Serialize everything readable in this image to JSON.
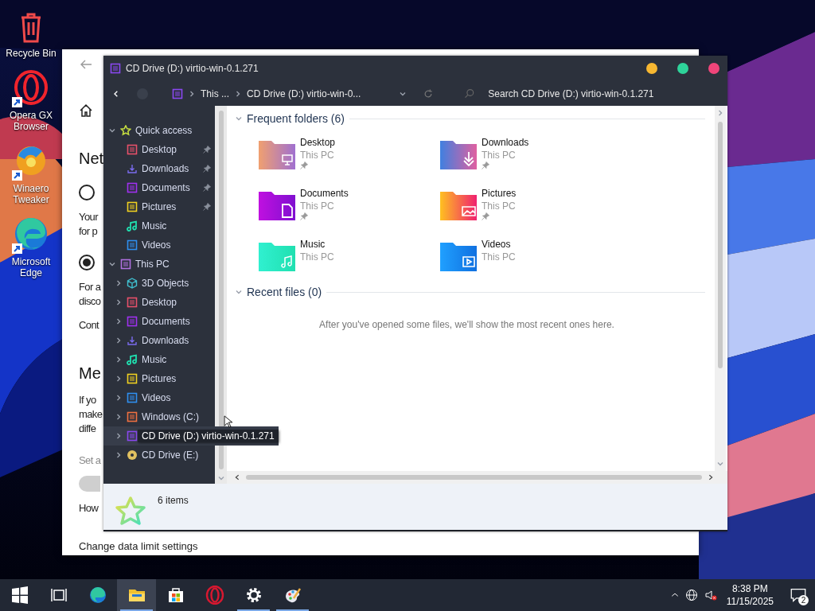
{
  "desktop_icons": [
    {
      "label": "Recycle Bin",
      "kind": "recycle",
      "shortcut": false
    },
    {
      "label": "Opera GX Browser",
      "kind": "opera",
      "shortcut": true
    },
    {
      "label": "Winaero Tweaker",
      "kind": "winaero",
      "shortcut": true
    },
    {
      "label": "Microsoft Edge",
      "kind": "edge",
      "shortcut": true
    }
  ],
  "settings_window": {
    "items": [
      {
        "kind": "heading",
        "text": "Net"
      },
      {
        "kind": "radio",
        "selected": false
      },
      {
        "kind": "text",
        "lines": [
          "Your",
          "for p"
        ]
      },
      {
        "kind": "radio",
        "selected": true
      },
      {
        "kind": "text",
        "lines": [
          "For a",
          "disco"
        ]
      },
      {
        "kind": "text",
        "lines": [
          "Cont"
        ]
      },
      {
        "kind": "heading",
        "text": "Me"
      },
      {
        "kind": "text",
        "lines": [
          "If yo",
          "make",
          "diffe"
        ]
      },
      {
        "kind": "hint",
        "text": "Set a"
      },
      {
        "kind": "toggle",
        "on": false
      },
      {
        "kind": "text",
        "lines": [
          "How"
        ]
      },
      {
        "kind": "link",
        "text": "Change data limit settings"
      }
    ]
  },
  "explorer": {
    "title": "CD Drive (D:) virtio-win-0.1.271",
    "breadcrumb": [
      "This ...",
      "CD Drive (D:) virtio-win-0..."
    ],
    "search": {
      "placeholder": "Search CD Drive (D:) virtio-win-0.1.271"
    },
    "nav": [
      {
        "label": "Quick access",
        "kind": "star",
        "expanded": true,
        "children": [
          {
            "label": "Desktop",
            "kind": "desktop",
            "pinned": true
          },
          {
            "label": "Downloads",
            "kind": "downloads",
            "pinned": true
          },
          {
            "label": "Documents",
            "kind": "documents",
            "pinned": true
          },
          {
            "label": "Pictures",
            "kind": "pictures",
            "pinned": true
          },
          {
            "label": "Music",
            "kind": "music",
            "pinned": false
          },
          {
            "label": "Videos",
            "kind": "videos",
            "pinned": false
          }
        ]
      },
      {
        "label": "This PC",
        "kind": "pc",
        "expanded": true,
        "children": [
          {
            "label": "3D Objects",
            "kind": "cube",
            "expanded": false,
            "hovered": false
          },
          {
            "label": "Desktop",
            "kind": "desktop",
            "expanded": false,
            "hovered": false
          },
          {
            "label": "Documents",
            "kind": "documents",
            "expanded": false,
            "hovered": false
          },
          {
            "label": "Downloads",
            "kind": "downloads",
            "expanded": false,
            "hovered": false
          },
          {
            "label": "Music",
            "kind": "music",
            "expanded": false,
            "hovered": false
          },
          {
            "label": "Pictures",
            "kind": "pictures",
            "expanded": false,
            "hovered": false
          },
          {
            "label": "Videos",
            "kind": "videos",
            "expanded": false,
            "hovered": false
          },
          {
            "label": "Windows (C:)",
            "kind": "drive-c",
            "expanded": false,
            "hovered": false
          },
          {
            "label": "CD Drive (D:) virtio-win-0.1.271",
            "kind": "cd-d",
            "expanded": false,
            "hovered": true
          },
          {
            "label": "CD Drive (E:)",
            "kind": "disc",
            "expanded": false,
            "hovered": false
          }
        ]
      }
    ],
    "sections": [
      {
        "title": "Frequent folders (6)",
        "expanded": true,
        "folders": [
          {
            "name": "Desktop",
            "location": "This PC",
            "kind": "desktop",
            "pinned": true
          },
          {
            "name": "Downloads",
            "location": "This PC",
            "kind": "downloads",
            "pinned": true
          },
          {
            "name": "Documents",
            "location": "This PC",
            "kind": "documents",
            "pinned": true
          },
          {
            "name": "Pictures",
            "location": "This PC",
            "kind": "pictures",
            "pinned": true
          },
          {
            "name": "Music",
            "location": "This PC",
            "kind": "music",
            "pinned": false
          },
          {
            "name": "Videos",
            "location": "This PC",
            "kind": "videos",
            "pinned": false
          }
        ]
      },
      {
        "title": "Recent files (0)",
        "expanded": true,
        "empty_text": "After you've opened some files, we'll show the most recent ones here."
      }
    ],
    "status": {
      "item_count": "6 items"
    }
  },
  "taskbar": {
    "apps": [
      {
        "kind": "start",
        "running": false,
        "selected": false
      },
      {
        "kind": "task-view",
        "running": false,
        "selected": false
      },
      {
        "kind": "edge",
        "running": false,
        "selected": false
      },
      {
        "kind": "explorer",
        "running": true,
        "selected": true
      },
      {
        "kind": "store",
        "running": false,
        "selected": false
      },
      {
        "kind": "opera",
        "running": false,
        "selected": false
      },
      {
        "kind": "settings",
        "running": true,
        "selected": false
      },
      {
        "kind": "paint",
        "running": true,
        "selected": false
      }
    ],
    "time": "8:38 PM",
    "date": "11/15/2025",
    "notifications": "2"
  }
}
